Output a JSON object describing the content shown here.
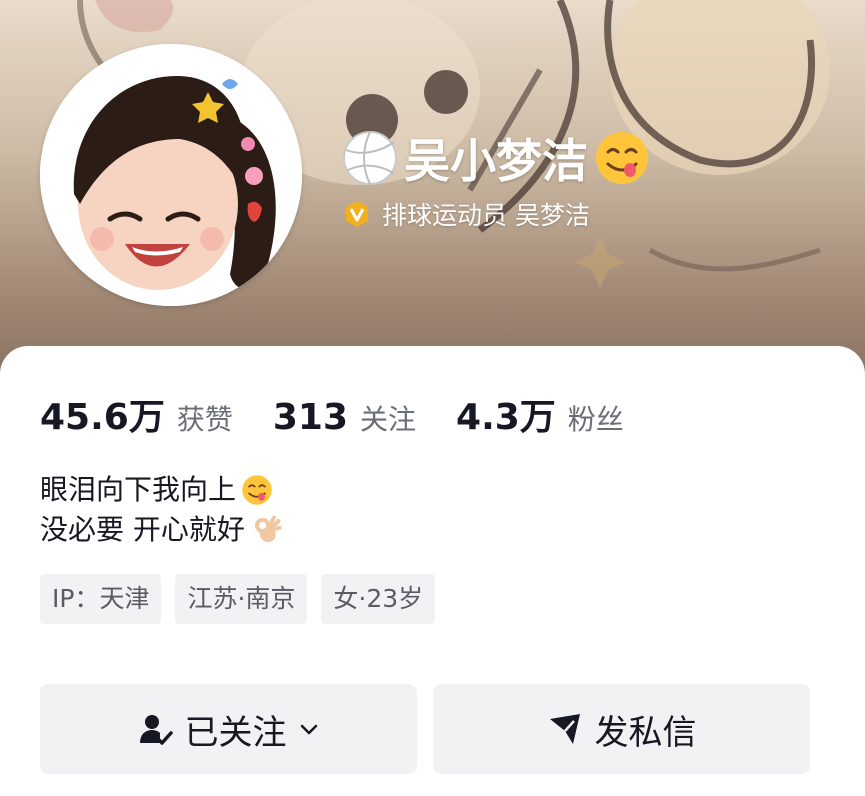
{
  "profile": {
    "name": "吴小梦洁",
    "verification": "排球运动员 吴梦洁"
  },
  "stats": [
    {
      "value": "45.6万",
      "label": "获赞"
    },
    {
      "value": "313",
      "label": "关注"
    },
    {
      "value": "4.3万",
      "label": "粉丝"
    }
  ],
  "bio": {
    "line1": "眼泪向下我向上",
    "line2": "没必要 开心就好"
  },
  "tags": [
    "IP：天津",
    "江苏·南京",
    "女·23岁"
  ],
  "actions": {
    "follow_label": "已关注",
    "message_label": "发私信"
  },
  "icons": {
    "name_prefix": "volleyball-icon",
    "name_suffix": "yum-face-emoji",
    "verify": "verified-badge-icon",
    "bio_line1": "yum-face-emoji",
    "bio_line2": "ok-hand-emoji",
    "follow": "person-check-icon",
    "follow_dropdown": "chevron-down-icon",
    "message": "paper-plane-icon"
  },
  "colors": {
    "text_primary": "#161823",
    "text_secondary": "#6b6e77",
    "button_bg": "#f2f2f4",
    "verify_gold": "#f2b01e"
  }
}
